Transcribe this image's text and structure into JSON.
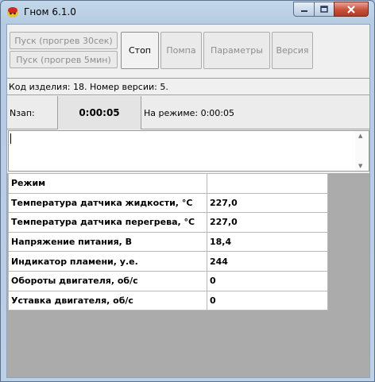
{
  "window": {
    "title": "Гном 6.1.0",
    "controls": {
      "minimize": "minimize-icon",
      "maximize": "maximize-icon",
      "close": "close-icon"
    }
  },
  "toolbar": {
    "start_30_label": "Пуск (прогрев 30сек)",
    "start_5_label": "Пуск (прогрев 5мин)",
    "stop_label": "Стоп",
    "pump_label": "Помпа",
    "params_label": "Параметры",
    "version_label": "Версия"
  },
  "info": {
    "device_code": "Код изделия: 18. Номер версии: 5."
  },
  "status": {
    "nzap_label": "Nзап:",
    "timer": "0:00:05",
    "on_mode": "На режиме: 0:00:05"
  },
  "parameters": [
    {
      "name": "Режим",
      "value": ""
    },
    {
      "name": "Температура датчика жидкости, °С",
      "value": "227,0"
    },
    {
      "name": "Температура датчика перегрева, °С",
      "value": "227,0"
    },
    {
      "name": "Напряжение питания, В",
      "value": "18,4"
    },
    {
      "name": "Индикатор пламени, у.е.",
      "value": "244"
    },
    {
      "name": "Обороты двигателя, об/с",
      "value": "0"
    },
    {
      "name": "Уставка двигателя, об/с",
      "value": "0"
    }
  ]
}
